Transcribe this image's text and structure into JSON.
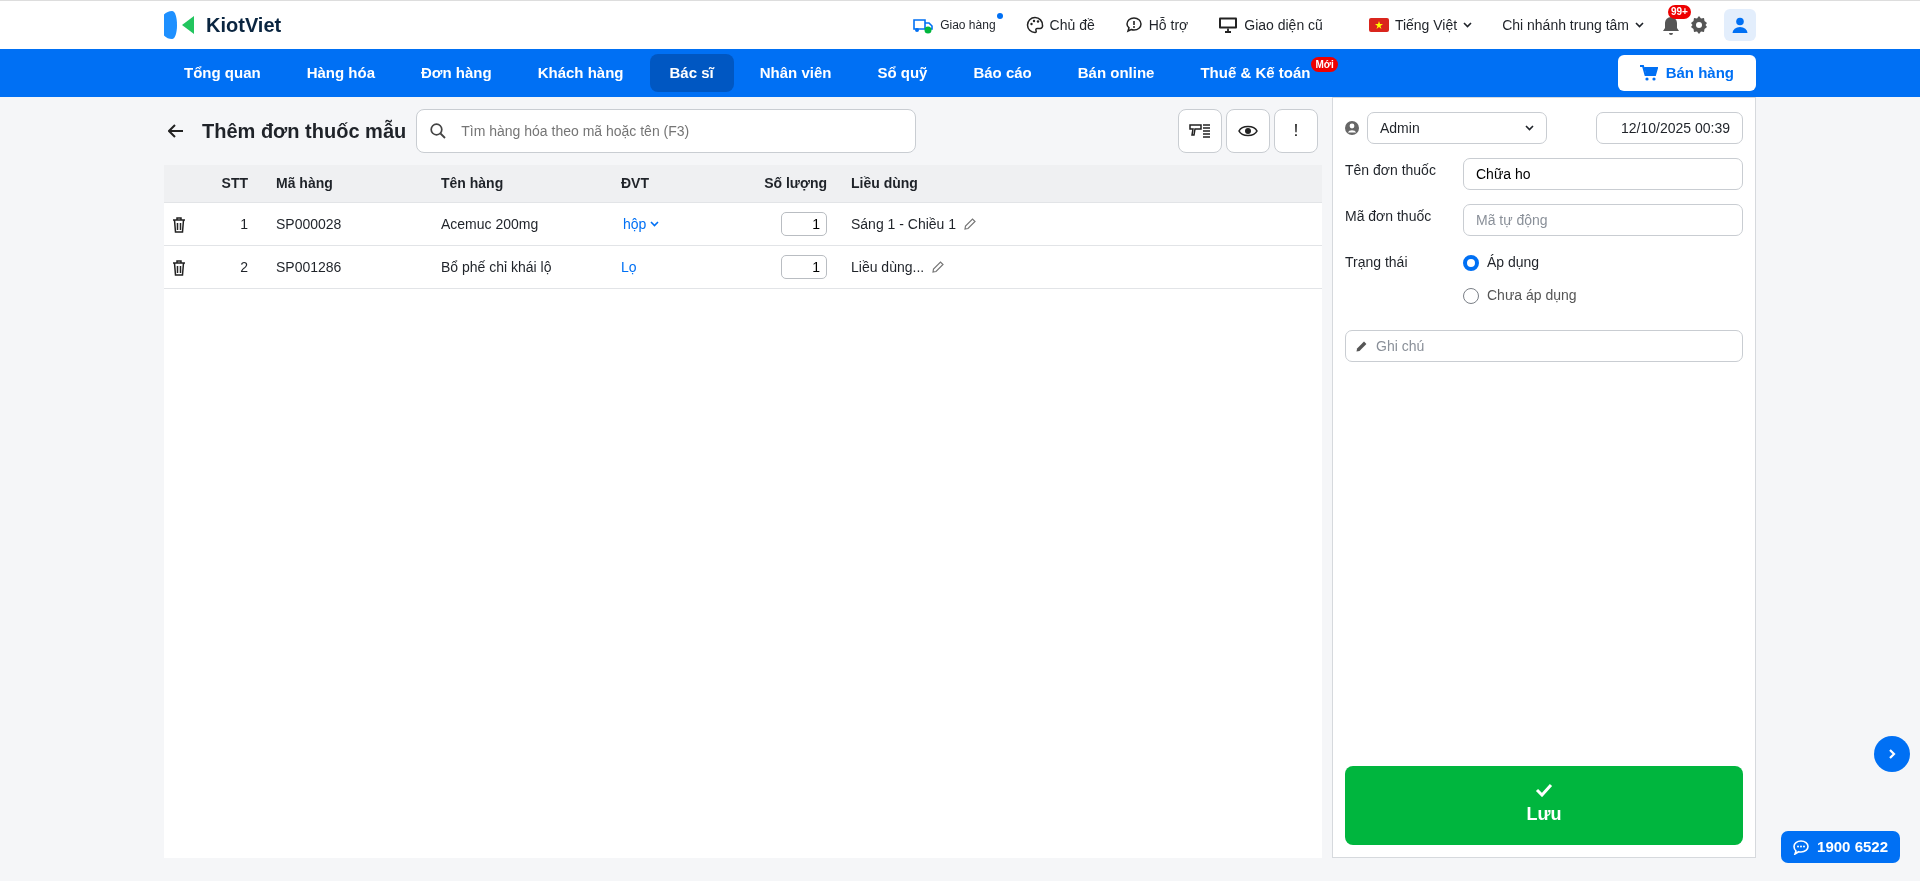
{
  "header": {
    "logo": "KiotViet",
    "links": [
      {
        "kind": "delivery",
        "label": "Giao hàng",
        "dot": true
      },
      {
        "kind": "theme",
        "label": "Chủ đề",
        "dot": false
      },
      {
        "kind": "support",
        "label": "Hỗ trợ",
        "dot": false
      },
      {
        "kind": "monitor",
        "label": "Giao diện cũ",
        "dot": false
      }
    ],
    "language": "Tiếng Việt",
    "branch": "Chi nhánh trung tâm",
    "notifications": "99+"
  },
  "nav": {
    "items": [
      {
        "label": "Tổng quan",
        "selected": false
      },
      {
        "label": "Hàng hóa",
        "selected": false
      },
      {
        "label": "Đơn hàng",
        "selected": false
      },
      {
        "label": "Khách hàng",
        "selected": false
      },
      {
        "label": "Bác sĩ",
        "selected": true
      },
      {
        "label": "Nhân viên",
        "selected": false
      },
      {
        "label": "Sổ quỹ",
        "selected": false
      },
      {
        "label": "Báo cáo",
        "selected": false
      },
      {
        "label": "Bán online",
        "selected": false
      },
      {
        "label": "Thuế & Kế toán",
        "selected": false,
        "badge": "Mới"
      }
    ],
    "sell_button": "Bán hàng"
  },
  "page": {
    "title": "Thêm đơn thuốc mẫu",
    "search": {
      "placeholder": "Tìm hàng hóa theo mã hoặc tên (F3)"
    },
    "tools": [
      {
        "kind": "scanner"
      },
      {
        "kind": "preview"
      },
      {
        "kind": "text",
        "label": "!"
      }
    ]
  },
  "table": {
    "columns": [
      "STT",
      "Mã hàng",
      "Tên hàng",
      "ĐVT",
      "Số lượng",
      "Liều dùng"
    ],
    "rows": [
      {
        "stt": "1",
        "code": "SP000028",
        "name": "Acemuc 200mg",
        "unit": "hộp",
        "unit_dropdown": true,
        "quantity": "1",
        "dosage": "Sáng 1 - Chiều 1"
      },
      {
        "stt": "2",
        "code": "SP001286",
        "name": "Bổ phế chỉ khái lộ",
        "unit": "Lọ",
        "unit_dropdown": false,
        "quantity": "1",
        "dosage": "Liều dùng..."
      }
    ]
  },
  "form": {
    "user": "Admin",
    "datetime": "12/10/2025 00:39",
    "fields": [
      {
        "label": "Tên đơn thuốc",
        "value": "Chữa ho"
      },
      {
        "label": "Mã đơn thuốc",
        "placeholder": "Mã tự động"
      }
    ],
    "status": {
      "label": "Trạng thái",
      "options": [
        {
          "label": "Áp dụng",
          "selected": true
        },
        {
          "label": "Chưa áp dụng",
          "selected": false
        }
      ]
    },
    "note": {
      "placeholder": "Ghi chú"
    },
    "save_button": "Lưu"
  },
  "hotline": "1900 6522"
}
